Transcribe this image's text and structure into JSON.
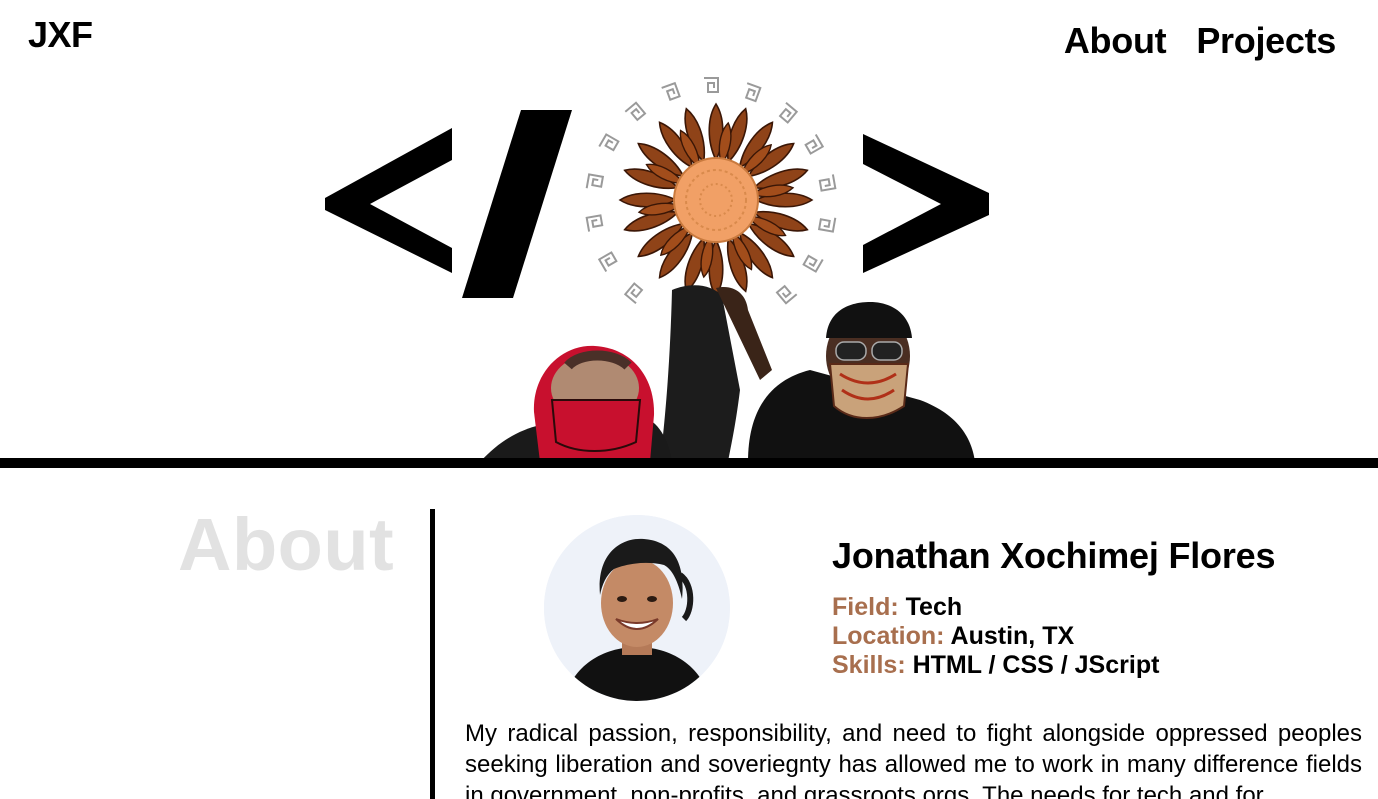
{
  "header": {
    "logo": "JXF",
    "nav": [
      {
        "label": "About"
      },
      {
        "label": "Projects"
      }
    ]
  },
  "hero": {
    "code_symbols": [
      "<",
      "/",
      ">"
    ],
    "colors": {
      "flower": "#8f4318",
      "flower_center": "#f1a066",
      "mask_red": "#c8102e",
      "symbols": "#000000"
    }
  },
  "about": {
    "section_title": "About",
    "name": "Jonathan Xochimej Flores",
    "details": [
      {
        "key": "Field:",
        "value": "Tech"
      },
      {
        "key": "Location:",
        "value": "Austin, TX"
      },
      {
        "key": "Skills:",
        "value": "HTML / CSS / JScript"
      }
    ],
    "bio": "My radical passion, responsibility, and need to fight alongside oppressed peoples seeking liberation and soveriegnty has allowed me to work in many difference fields in government, non-profits, and grassroots orgs. The needs for tech and for",
    "accent_color": "#a86f4e"
  }
}
